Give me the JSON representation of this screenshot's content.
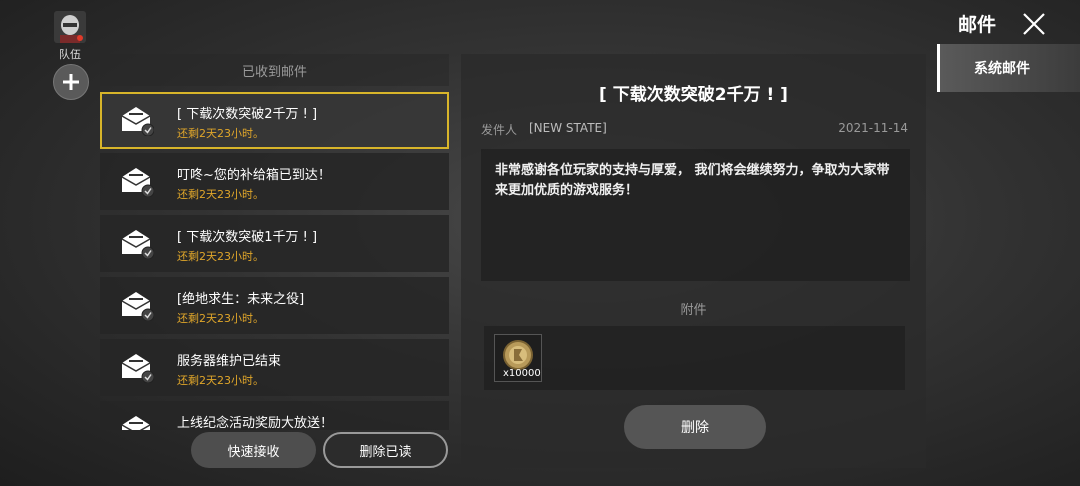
{
  "team": {
    "label": "队伍"
  },
  "header": {
    "title": "邮件"
  },
  "tabs": [
    {
      "label": "系统邮件"
    }
  ],
  "mail_list": {
    "header": "已收到邮件",
    "items": [
      {
        "title": "[ 下载次数突破2千万 ! ]",
        "remaining": "还剩2天23小时。"
      },
      {
        "title": "叮咚~您的补给箱已到达！",
        "remaining": "还剩2天23小时。"
      },
      {
        "title": "[ 下载次数突破1千万 ! ]",
        "remaining": "还剩2天23小时。"
      },
      {
        "title": "[绝地求生：未来之役]",
        "remaining": "还剩2天23小时。"
      },
      {
        "title": "服务器维护已结束",
        "remaining": "还剩2天23小时。"
      },
      {
        "title": "上线纪念活动奖励大放送！",
        "remaining": ""
      }
    ]
  },
  "buttons": {
    "quick_receive": "快速接收",
    "delete_read": "删除已读",
    "delete": "删除"
  },
  "detail": {
    "title": "[ 下载次数突破2千万 ! ]",
    "sender_label": "发件人",
    "sender": "[NEW STATE]",
    "date": "2021-11-14",
    "body": "非常感谢各位玩家的支持与厚爱， 我们将会继续努力，争取为大家带来更加优质的游戏服务！",
    "attachments_label": "附件",
    "attachments": [
      {
        "count": "x10000",
        "icon": "coin-icon"
      }
    ]
  }
}
